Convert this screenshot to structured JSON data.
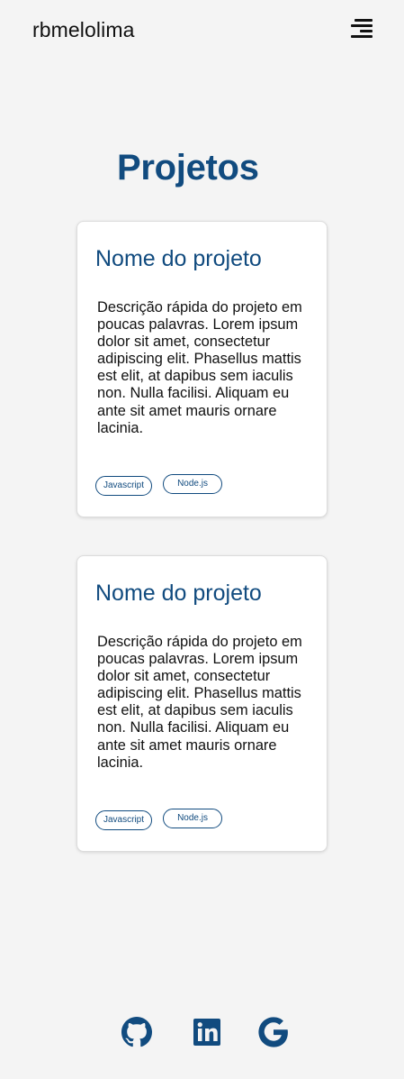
{
  "header": {
    "brand": "rbmelolima",
    "menu_icon": "menu-icon"
  },
  "main": {
    "title": "Projetos",
    "projects": [
      {
        "title": "Nome do projeto",
        "description": "Descrição rápida do projeto em poucas palavras. Lorem ipsum dolor sit amet, consectetur adipiscing elit. Phasellus mattis est elit, at dapibus sem iaculis non. Nulla facilisi. Aliquam eu ante sit amet mauris ornare lacinia.",
        "tags": [
          "Javascript",
          "Node.js"
        ]
      },
      {
        "title": "Nome do projeto",
        "description": "Descrição rápida do projeto em poucas palavras. Lorem ipsum dolor sit amet, consectetur adipiscing elit. Phasellus mattis est elit, at dapibus sem iaculis non. Nulla facilisi. Aliquam eu ante sit amet mauris ornare lacinia.",
        "tags": [
          "Javascript",
          "Node.js"
        ]
      }
    ]
  },
  "footer": {
    "social": [
      "github-icon",
      "linkedin-icon",
      "google-icon"
    ]
  },
  "colors": {
    "background": "#f4f4f4",
    "accent": "#114b7f",
    "text": "#111111"
  }
}
